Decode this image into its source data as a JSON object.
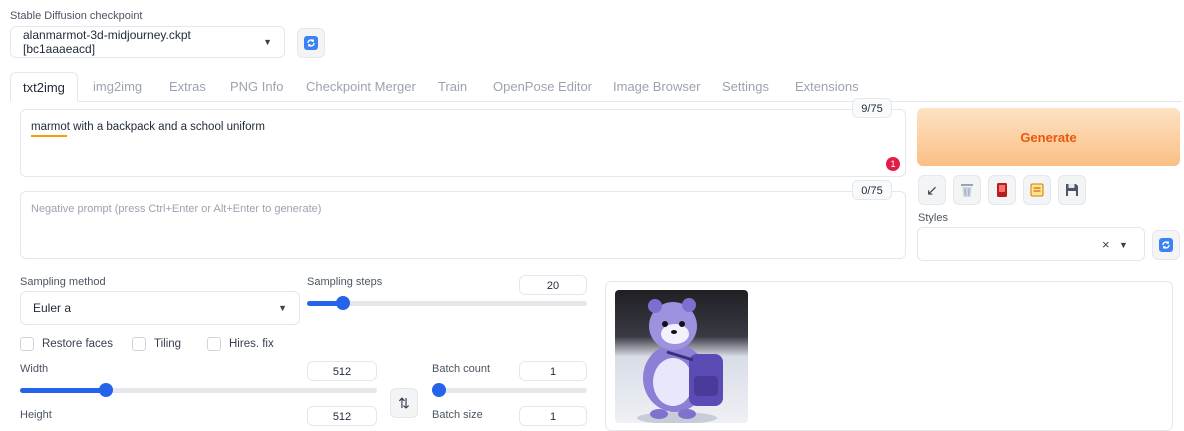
{
  "checkpoint": {
    "label": "Stable Diffusion checkpoint",
    "value": "alanmarmot-3d-midjourney.ckpt [bc1aaaeacd]"
  },
  "tabs": [
    {
      "label": "txt2img",
      "active": true
    },
    {
      "label": "img2img"
    },
    {
      "label": "Extras"
    },
    {
      "label": "PNG Info"
    },
    {
      "label": "Checkpoint Merger"
    },
    {
      "label": "Train"
    },
    {
      "label": "OpenPose Editor"
    },
    {
      "label": "Image Browser"
    },
    {
      "label": "Settings"
    },
    {
      "label": "Extensions"
    }
  ],
  "prompt": {
    "value": "marmot with a backpack and a school uniform",
    "token_count": "9/75",
    "error_badge": "1"
  },
  "negative_prompt": {
    "placeholder": "Negative prompt (press Ctrl+Enter or Alt+Enter to generate)",
    "token_count": "0/75"
  },
  "generate": {
    "label": "Generate",
    "color": "#f97316"
  },
  "styles": {
    "label": "Styles",
    "clear": "×"
  },
  "sampling_method": {
    "label": "Sampling method",
    "value": "Euler a"
  },
  "sampling_steps": {
    "label": "Sampling steps",
    "value": "20",
    "fraction": 0.13
  },
  "checkboxes": [
    {
      "label": "Restore faces",
      "checked": false
    },
    {
      "label": "Tiling",
      "checked": false
    },
    {
      "label": "Hires. fix",
      "checked": false
    }
  ],
  "width": {
    "label": "Width",
    "value": "512",
    "fraction": 0.24
  },
  "height": {
    "label": "Height",
    "value": "512"
  },
  "swap_icon": "⇅",
  "batch_count": {
    "label": "Batch count",
    "value": "1",
    "fraction": 0.0
  },
  "batch_size": {
    "label": "Batch size",
    "value": "1"
  },
  "colors": {
    "accent": "#2563eb",
    "generate_start": "#fed7aa",
    "generate_end": "#fdba74",
    "error": "#e11d48"
  }
}
